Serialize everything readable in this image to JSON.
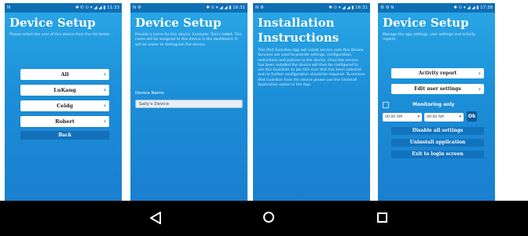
{
  "screens": [
    {
      "status_left": "N",
      "status_right": "✱ ✆ ⊙ ▾ ◢ ◢ ▮ 11:33",
      "title": "Device Setup",
      "description": "Please select the user of this device from the list below",
      "users": [
        "All",
        "LuKang",
        "Ceidg",
        "Robert"
      ],
      "back_label": "Back"
    },
    {
      "status_left": "N ⚙",
      "status_right": "✱ ⊙ ▾ ◢ ◢ ▮ 16:31",
      "title": "Device Setup",
      "description": "Provide a name for this device. Example: Tom's tablet. The name will be assigned to this device in the dashboard. It will be easier to distinguish the device.",
      "field_label": "Device Name",
      "field_value": "Sally's Device"
    },
    {
      "status_left": "N ⚙",
      "status_right": "✱ ⊙ ▾ ◢ ◢ ▮ 16:31",
      "title": "Installation Instructions",
      "description": "This iPad Guardian App will install service onto this Device. Services are used to provide settings, configuration, restrictions and policies to the device. Once the service has been installed the device will then be configured to use this Guardian as per this user that has been selected and no further configuration should be required. To remove iPad Guardian from the device please use the Uninstall Application option in the App."
    },
    {
      "status_left": "⚙ ⚙ N",
      "status_right": "✱ ⊙ ▾ ◢ ◢ ▮ 17:38",
      "title": "Device Setup",
      "description": "Manage the app settings, user settings and activity reports.",
      "activity_label": "Activity report",
      "edit_label": "Edit user settings",
      "monitoring_label": "Monitoring only",
      "time_from": "00:00 AM",
      "time_to": "00:00 AM",
      "ok_label": "Ok",
      "disable_label": "Disable all settings",
      "uninstall_label": "Uninstall application",
      "exit_label": "Exit to login screen"
    }
  ],
  "icons": {
    "back": "back-triangle-icon",
    "home": "home-circle-icon",
    "recents": "recents-square-icon"
  }
}
